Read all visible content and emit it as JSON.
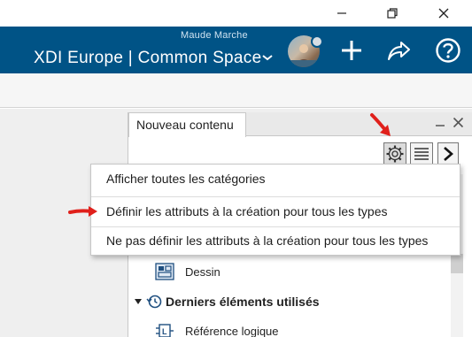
{
  "window": {
    "controls": [
      "minimize-icon",
      "restore-icon",
      "close-icon"
    ]
  },
  "header": {
    "user_name": "Maude Marche",
    "title": "XDI Europe | Common Space",
    "icons": [
      "avatar",
      "add-icon",
      "share-icon",
      "help-icon"
    ],
    "color": "#005386"
  },
  "panel": {
    "tab_label": "Nouveau contenu",
    "tools": [
      "gear-icon",
      "list-icon",
      "expand-icon"
    ]
  },
  "menu": {
    "items": [
      "Afficher toutes les catégories",
      "Définir les attributs à la création pour tous les types",
      "Ne pas définir les attributs à la création pour tous les types"
    ]
  },
  "tree": {
    "dessin_label": "Dessin",
    "recent_section": "Derniers éléments utilisés",
    "reference_label": "Référence logique"
  },
  "annotation_color": "#e0201b"
}
